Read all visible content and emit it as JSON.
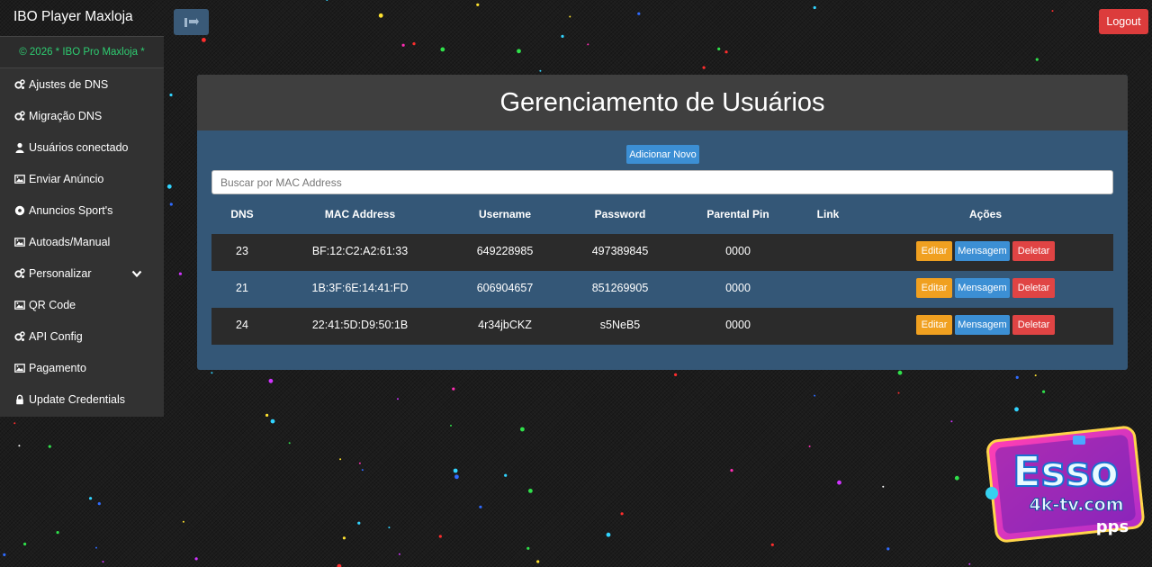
{
  "app": {
    "title": "IBO Player Maxloja",
    "logout_label": "Logout"
  },
  "sidebar": {
    "copyright": "© 2026 * IBO Pro Maxloja *",
    "items": [
      {
        "label": "Ajustes de DNS",
        "icon": "gears-icon"
      },
      {
        "label": "Migração DNS",
        "icon": "gears-icon"
      },
      {
        "label": "Usuários conectado",
        "icon": "user-icon"
      },
      {
        "label": "Enviar Anúncio",
        "icon": "image-icon"
      },
      {
        "label": "Anuncios Sport's",
        "icon": "soccer-ball-icon"
      },
      {
        "label": "Autoads/Manual",
        "icon": "image-icon"
      },
      {
        "label": "Personalizar",
        "icon": "gears-icon"
      },
      {
        "label": "QR Code",
        "icon": "image-icon"
      },
      {
        "label": "API Config",
        "icon": "gears-icon"
      },
      {
        "label": "Pagamento",
        "icon": "image-icon"
      },
      {
        "label": "Update Credentials",
        "icon": "lock-icon"
      }
    ]
  },
  "main": {
    "title": "Gerenciamento de Usuários",
    "add_label": "Adicionar Novo",
    "search_placeholder": "Buscar por MAC Address",
    "columns": [
      "DNS",
      "MAC Address",
      "Username",
      "Password",
      "Parental Pin",
      "Link",
      "Ações"
    ],
    "rows": [
      {
        "dns": "23",
        "mac": "BF:12:C2:A2:61:33",
        "username": "649228985",
        "password": "497389845",
        "pin": "0000",
        "link": ""
      },
      {
        "dns": "21",
        "mac": "1B:3F:6E:14:41:FD",
        "username": "606904657",
        "password": "851269905",
        "pin": "0000",
        "link": ""
      },
      {
        "dns": "24",
        "mac": "22:41:5D:D9:50:1B",
        "username": "4r34jbCKZ",
        "password": "s5NeB5",
        "pin": "0000",
        "link": ""
      }
    ],
    "actions": {
      "edit": "Editar",
      "message": "Mensagem",
      "delete": "Deletar"
    }
  },
  "promo": {
    "line1": "Esso",
    "line2": "4k-tv.com",
    "line3": "pps"
  },
  "colors": {
    "accent": "#3c8fd4",
    "danger": "#dc3c3c",
    "warning": "#f0a020",
    "panel": "#345777",
    "copyright": "#2ecc71"
  }
}
